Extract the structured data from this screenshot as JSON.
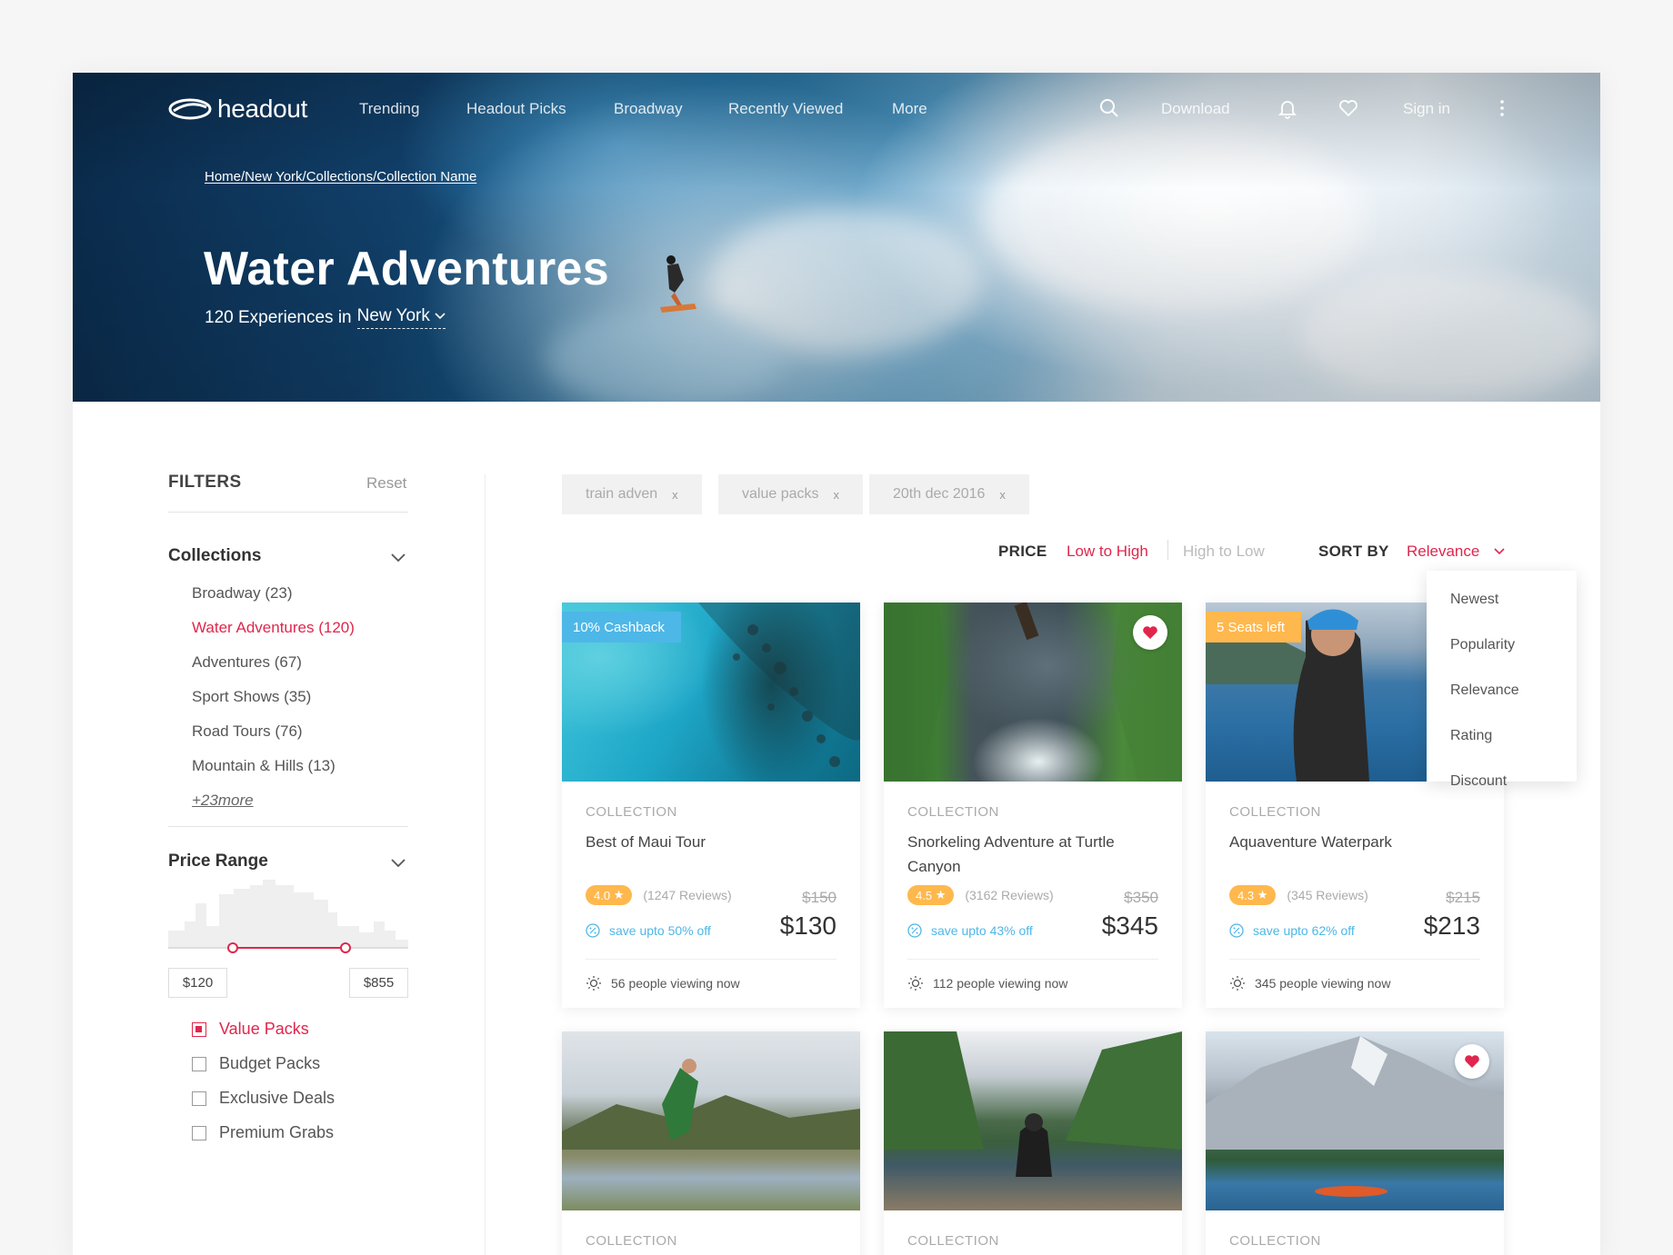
{
  "nav": {
    "logo_text": "headout",
    "items": [
      "Trending",
      "Headout Picks",
      "Broadway",
      "Recently Viewed",
      "More"
    ],
    "download": "Download",
    "sign_in": "Sign in"
  },
  "hero": {
    "breadcrumb": "Home/New York/Collections/Collection Name",
    "title": "Water Adventures",
    "subtitle_prefix": "120 Experiences in",
    "city": "New York"
  },
  "filters": {
    "heading": "FILTERS",
    "reset": "Reset",
    "collections_heading": "Collections",
    "collections": [
      {
        "label": "Broadway (23)",
        "active": false
      },
      {
        "label": "Water Adventures (120)",
        "active": true
      },
      {
        "label": "Adventures (67)",
        "active": false
      },
      {
        "label": "Sport Shows (35)",
        "active": false
      },
      {
        "label": "Road Tours (76)",
        "active": false
      },
      {
        "label": "Mountain & Hills (13)",
        "active": false
      }
    ],
    "more": "+23more",
    "price_heading": "Price Range",
    "price_min": "$120",
    "price_max": "$855",
    "range_low_fraction": 0.27,
    "range_high_fraction": 0.74,
    "checks": [
      {
        "label": "Value Packs",
        "checked": true
      },
      {
        "label": "Budget Packs",
        "checked": false
      },
      {
        "label": "Exclusive Deals",
        "checked": false
      },
      {
        "label": "Premium Grabs",
        "checked": false
      }
    ]
  },
  "chips": [
    "train adven",
    "value packs",
    "20th dec 2016"
  ],
  "sort": {
    "price_label": "PRICE",
    "low_high": "Low to High",
    "high_low": "High to Low",
    "sort_by": "SORT BY",
    "selected": "Relevance",
    "options": [
      "Newest",
      "Popularity",
      "Relevance",
      "Rating",
      "Discount"
    ]
  },
  "cards": [
    {
      "tag": "10% Cashback",
      "tag_color": "#4db7e8",
      "category": "COLLECTION",
      "title": "Best of Maui Tour",
      "rating": "4.0",
      "reviews": "(1247 Reviews)",
      "old_price": "$150",
      "save": "save upto 50% off",
      "price": "$130",
      "viewing": "56 people viewing now"
    },
    {
      "favorite": true,
      "category": "COLLECTION",
      "title": "Snorkeling Adventure at Turtle Canyon",
      "rating": "4.5",
      "reviews": "(3162 Reviews)",
      "old_price": "$350",
      "save": "save upto 43% off",
      "price": "$345",
      "viewing": "112 people viewing now"
    },
    {
      "tag": "5 Seats left",
      "tag_color": "#ffb84d",
      "category": "COLLECTION",
      "title": "Aquaventure Waterpark",
      "rating": "4.3",
      "reviews": "(345 Reviews)",
      "old_price": "$215",
      "save": "save upto 62% off",
      "price": "$213",
      "viewing": "345 people viewing now"
    },
    {
      "category": "COLLECTION"
    },
    {
      "category": "COLLECTION"
    },
    {
      "favorite": true,
      "category": "COLLECTION"
    }
  ],
  "colors": {
    "accent": "#e0264c",
    "info": "#4db7e8",
    "rating": "#ffb84d"
  }
}
